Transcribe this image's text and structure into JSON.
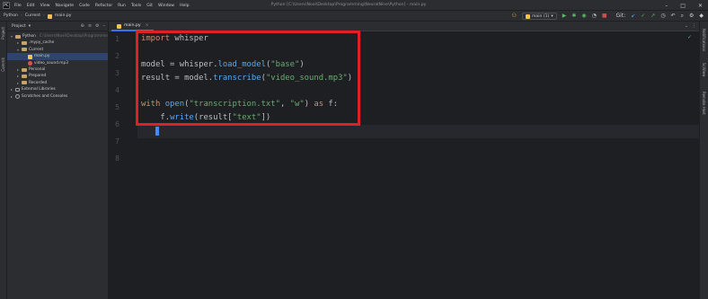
{
  "titlebar": {
    "menu": [
      "File",
      "Edit",
      "View",
      "Navigate",
      "Code",
      "Refactor",
      "Run",
      "Tools",
      "Git",
      "Window",
      "Help"
    ],
    "window_title": "Python [C:\\Users\\Noel\\Desktop\\Programming\\NeuralNine\\Python] - main.py"
  },
  "navbar": {
    "breadcrumb": [
      "Python",
      "Current",
      "main.py"
    ],
    "run_config": "main (1)",
    "git_label": "Git:"
  },
  "left_strip": {
    "labels": [
      "Project",
      "Commit"
    ]
  },
  "right_strip": {
    "labels": [
      "Notifications",
      "SciView",
      "Remote Host"
    ]
  },
  "project": {
    "header_label": "Project",
    "tree": [
      {
        "label": "Python",
        "detail": "C:\\Users\\Noel\\Desktop\\Programmin",
        "indent": 0,
        "arrow": "▾",
        "icon": "folder"
      },
      {
        "label": ".mypy_cache",
        "indent": 1,
        "arrow": "▸",
        "icon": "folder"
      },
      {
        "label": "Current",
        "indent": 1,
        "arrow": "▾",
        "icon": "folder"
      },
      {
        "label": "main.py",
        "indent": 2,
        "arrow": "",
        "icon": "python-file",
        "selected": true
      },
      {
        "label": "video_sound.mp3",
        "indent": 2,
        "arrow": "",
        "icon": "audio-file"
      },
      {
        "label": "Personal",
        "indent": 1,
        "arrow": "▸",
        "icon": "folder"
      },
      {
        "label": "Prepared",
        "indent": 1,
        "arrow": "▸",
        "icon": "folder"
      },
      {
        "label": "Recorded",
        "indent": 1,
        "arrow": "▸",
        "icon": "folder"
      },
      {
        "label": "External Libraries",
        "indent": 0,
        "arrow": "▸",
        "icon": "library"
      },
      {
        "label": "Scratches and Consoles",
        "indent": 0,
        "arrow": "▸",
        "icon": "scratches"
      }
    ]
  },
  "editor": {
    "tab_label": "main.py",
    "line_numbers": [
      "1",
      "2",
      "3",
      "4",
      "5",
      "6",
      "7",
      "8"
    ],
    "code": {
      "l1_kw": "import",
      "l1_rest": " whisper",
      "l3_a": "model = whisper.",
      "l3_fn": "load_model",
      "l3_b": "(",
      "l3_str": "\"base\"",
      "l3_c": ")",
      "l4_a": "result = model.",
      "l4_fn": "transcribe",
      "l4_b": "(",
      "l4_str": "\"video_sound.mp3\"",
      "l4_c": ")",
      "l6_kw": "with",
      "l6_sp": " ",
      "l6_fn": "open",
      "l6_a": "(",
      "l6_str1": "\"transcription.txt\"",
      "l6_b": ", ",
      "l6_str2": "\"w\"",
      "l6_c": ") ",
      "l6_kw2": "as",
      "l6_d": " f:",
      "l7_a": "    f.",
      "l7_fn": "write",
      "l7_b": "(result[",
      "l7_str": "\"text\"",
      "l7_c": "])"
    },
    "highlight_color": "#e01f26"
  }
}
